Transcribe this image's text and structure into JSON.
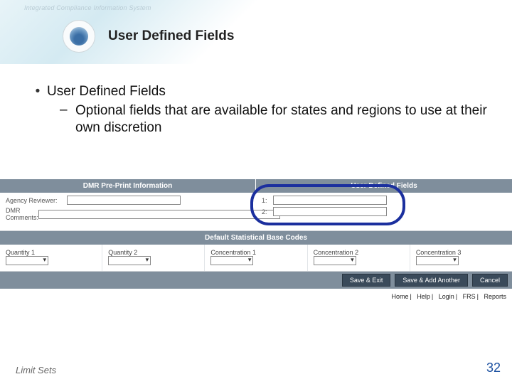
{
  "header": {
    "system": "Integrated Compliance Information System",
    "title": "User Defined Fields"
  },
  "content": {
    "bullet1": "User Defined Fields",
    "sub1": "Optional fields that are available for states and regions to use at their own discretion"
  },
  "app": {
    "left_header": "DMR Pre-Print Information",
    "right_header": "User Defined Fields",
    "agency_reviewer": "Agency Reviewer:",
    "dmr_comments": "DMR Comments:",
    "udf1_label": "1:",
    "udf2_label": "2:",
    "sub_header": "Default Statistical Base Codes",
    "cols": {
      "q1": "Quantity 1",
      "q2": "Quantity 2",
      "c1": "Concentration 1",
      "c2": "Concentration 2",
      "c3": "Concentration 3"
    },
    "buttons": {
      "save_exit": "Save & Exit",
      "save_add": "Save & Add Another",
      "cancel": "Cancel"
    },
    "links": {
      "home": "Home",
      "help": "Help",
      "login": "Login",
      "frs": "FRS",
      "reports": "Reports"
    }
  },
  "footer": {
    "section": "Limit Sets",
    "page": "32"
  }
}
